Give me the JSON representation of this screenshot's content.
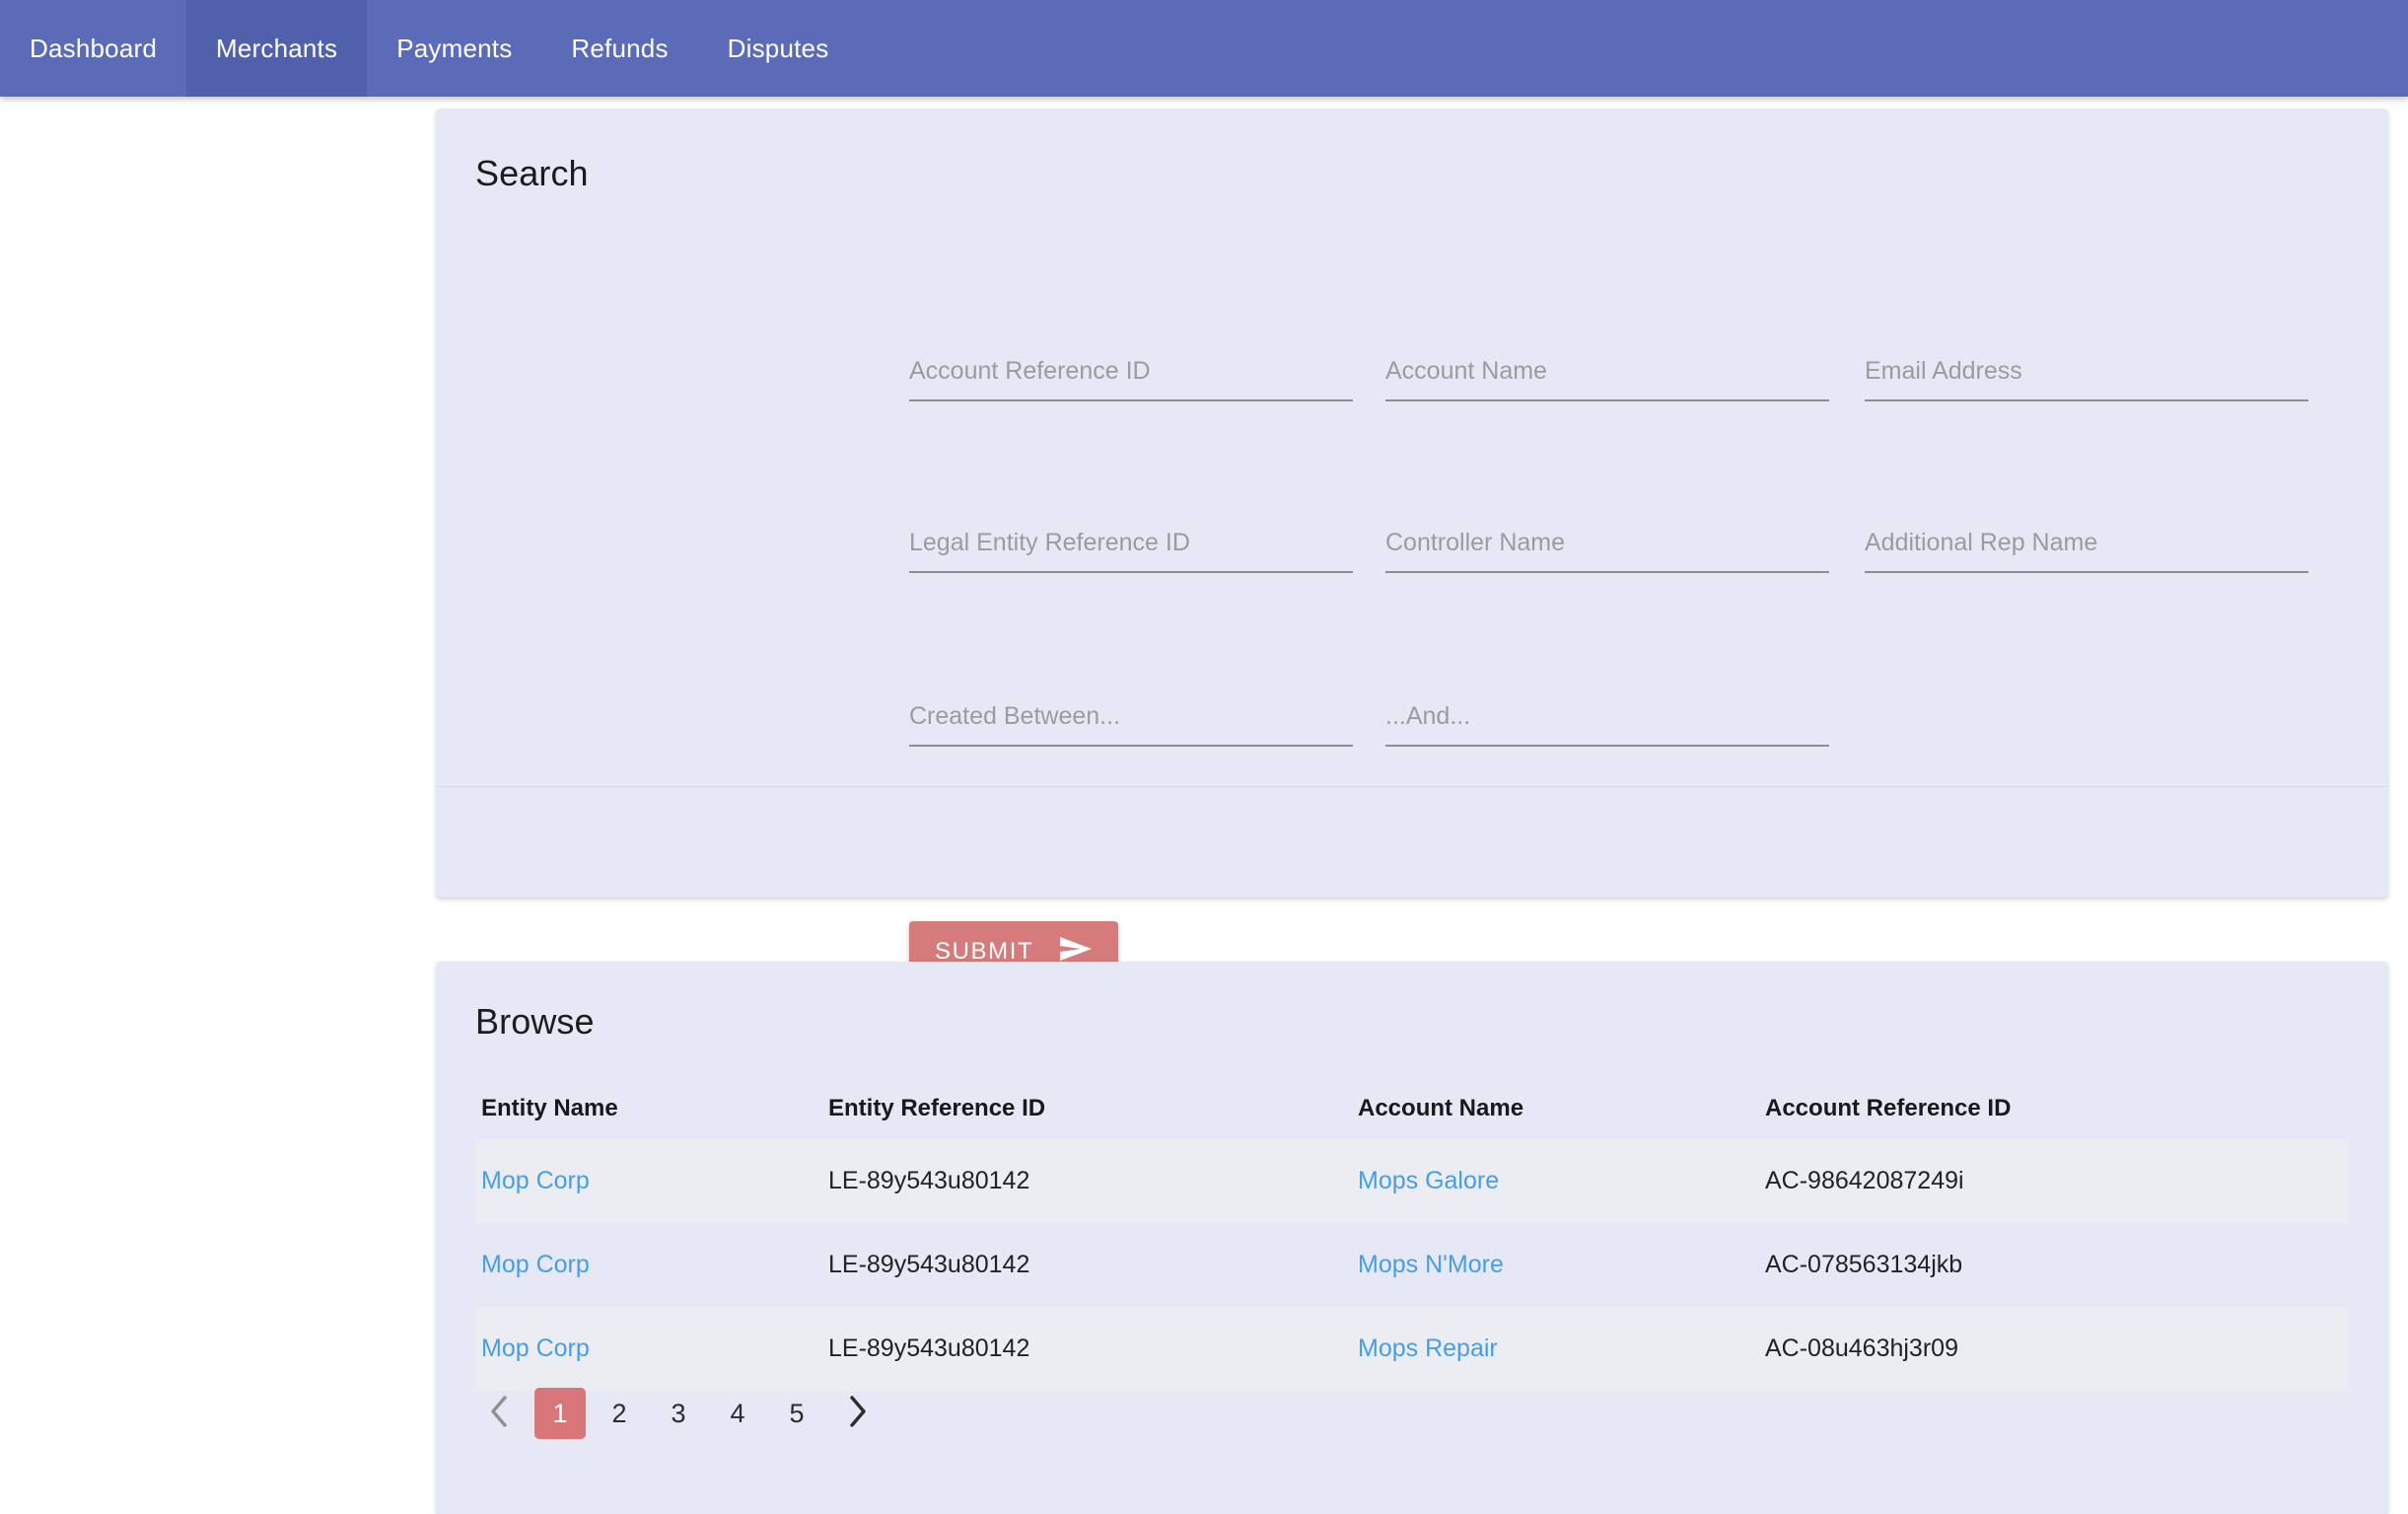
{
  "nav": {
    "tabs": [
      {
        "label": "Dashboard",
        "active": false
      },
      {
        "label": "Merchants",
        "active": true
      },
      {
        "label": "Payments",
        "active": false
      },
      {
        "label": "Refunds",
        "active": false
      },
      {
        "label": "Disputes",
        "active": false
      }
    ]
  },
  "search": {
    "title": "Search",
    "fields": {
      "account_reference_id": {
        "placeholder": "Account Reference ID",
        "value": ""
      },
      "account_name": {
        "placeholder": "Account Name",
        "value": ""
      },
      "email_address": {
        "placeholder": "Email Address",
        "value": ""
      },
      "legal_entity_reference_id": {
        "placeholder": "Legal Entity Reference ID",
        "value": ""
      },
      "controller_name": {
        "placeholder": "Controller Name",
        "value": ""
      },
      "additional_rep_name": {
        "placeholder": "Additional Rep Name",
        "value": ""
      },
      "created_between": {
        "placeholder": "Created Between...",
        "value": ""
      },
      "created_and": {
        "placeholder": "...And...",
        "value": ""
      }
    },
    "submit_label": "SUBMIT",
    "submit_icon": "send-icon"
  },
  "browse": {
    "title": "Browse",
    "columns": [
      "Entity Name",
      "Entity Reference ID",
      "Account Name",
      "Account Reference ID"
    ],
    "rows": [
      {
        "entity_name": "Mop Corp",
        "entity_reference_id": "LE-89y543u80142",
        "account_name": "Mops Galore",
        "account_reference_id": "AC-98642087249i"
      },
      {
        "entity_name": "Mop Corp",
        "entity_reference_id": "LE-89y543u80142",
        "account_name": "Mops N'More",
        "account_reference_id": "AC-078563134jkb"
      },
      {
        "entity_name": "Mop Corp",
        "entity_reference_id": "LE-89y543u80142",
        "account_name": "Mops Repair",
        "account_reference_id": "AC-08u463hj3r09"
      }
    ],
    "pagination": {
      "prev_icon": "chevron-left-icon",
      "next_icon": "chevron-right-icon",
      "pages": [
        "1",
        "2",
        "3",
        "4",
        "5"
      ],
      "current_page": "1"
    }
  },
  "colors": {
    "nav_background": "#5c6bb8",
    "nav_active_tab": "#5060ab",
    "panel_background": "#e6e9f5",
    "row_alt_background": "#ebedf2",
    "accent_submit": "#d57b7b",
    "accent_pagination_active": "#d9767a",
    "link": "#479ee6",
    "placeholder_text": "#9b9b9f",
    "page_background": "#ffffff"
  }
}
